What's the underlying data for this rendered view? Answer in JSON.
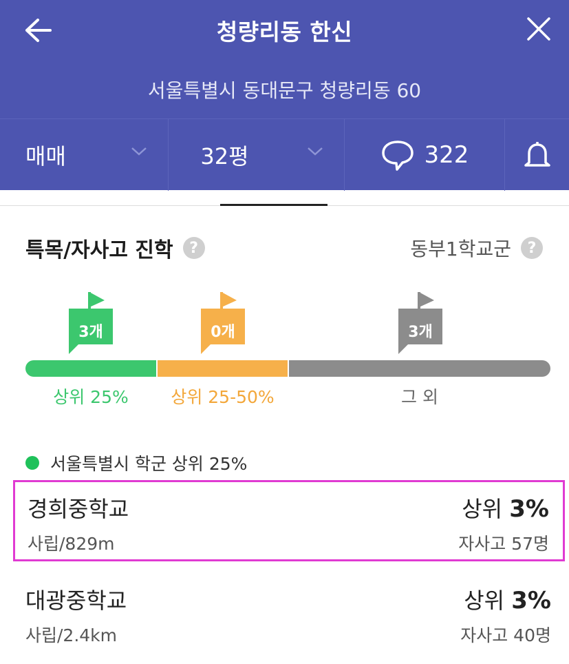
{
  "header": {
    "title": "청량리동 한신",
    "address": "서울특별시 동대문구 청량리동 60",
    "filters": {
      "trade_type": "매매",
      "size": "32평",
      "comment_count": "322"
    },
    "icons": [
      "back-arrow-icon",
      "close-icon",
      "chevron-down-icon",
      "speech-bubble-icon",
      "bell-icon"
    ]
  },
  "section": {
    "title": "특목/자사고 진학",
    "district": "동부1학교군",
    "help_glyph": "?"
  },
  "tiers": [
    {
      "label": "상위 25%",
      "count": "3개",
      "color": "#3cc76e"
    },
    {
      "label": "상위 25-50%",
      "count": "0개",
      "color": "#f6b04a"
    },
    {
      "label": "그 외",
      "count": "3개",
      "color": "#8c8c8c"
    }
  ],
  "legend": {
    "text": "서울특별시 학군 상위 25%",
    "color": "#1fc15a"
  },
  "schools": [
    {
      "name": "경희중학교",
      "meta": "사립/829m",
      "rank_prefix": "상위",
      "rank_value": "3%",
      "count": "자사고 57명",
      "highlighted": true
    },
    {
      "name": "대광중학교",
      "meta": "사립/2.4km",
      "rank_prefix": "상위",
      "rank_value": "3%",
      "count": "자사고 40명",
      "highlighted": false
    }
  ],
  "colors": {
    "header_bg": "#4d55b0",
    "highlight_border": "#e03ad2"
  }
}
